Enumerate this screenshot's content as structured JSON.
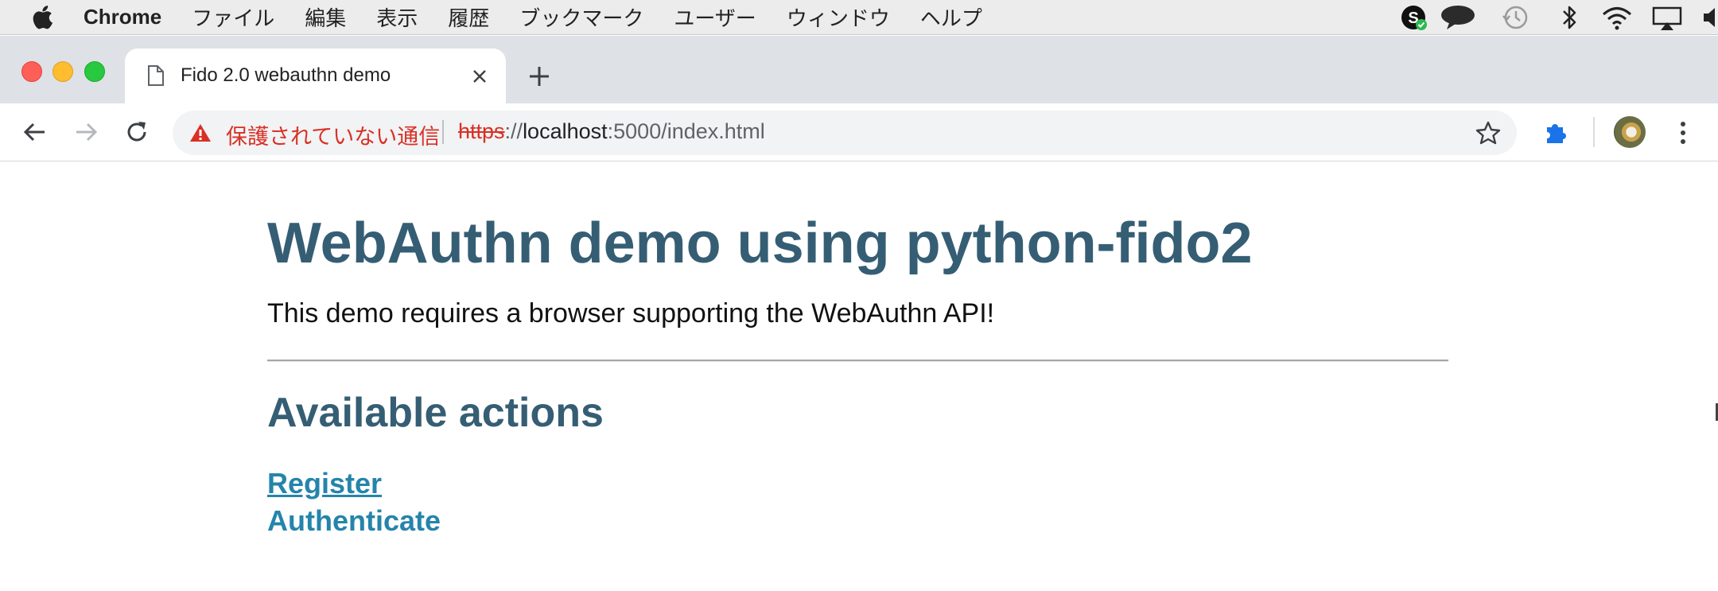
{
  "menubar": {
    "app_name": "Chrome",
    "items": [
      "ファイル",
      "編集",
      "表示",
      "履歴",
      "ブックマーク",
      "ユーザー",
      "ウィンドウ",
      "ヘルプ"
    ],
    "status_icons": [
      "skype-icon",
      "chat-bubble-icon",
      "time-machine-icon",
      "bluetooth-icon",
      "wifi-icon",
      "airplay-icon",
      "volume-icon"
    ]
  },
  "tab": {
    "title": "Fido 2.0 webauthn demo",
    "icon": "document-icon"
  },
  "toolbar": {
    "security_label": "保護されていない通信",
    "url_scheme": "https",
    "url_separator": "://",
    "url_host": "localhost",
    "url_rest": ":5000/index.html",
    "extensions_icon": "puzzle-icon",
    "accent_blue": "#1a73e8",
    "warning_red": "#d93025"
  },
  "page": {
    "title": "WebAuthn demo using python-fido2",
    "intro": "This demo requires a browser supporting the WebAuthn API!",
    "section_title": "Available actions",
    "links": {
      "register": "Register",
      "authenticate": "Authenticate"
    },
    "heading_color": "#355e74",
    "link_color": "#2584ab"
  }
}
